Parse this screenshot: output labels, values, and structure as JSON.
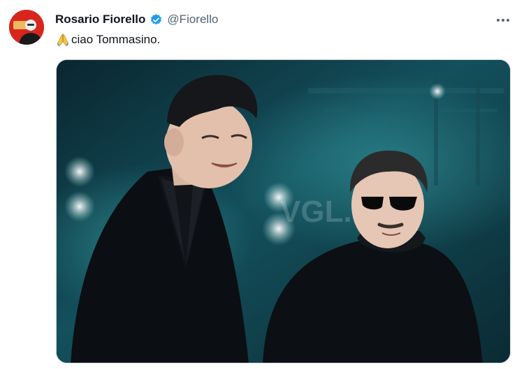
{
  "tweet": {
    "author": {
      "display_name": "Rosario Fiorello",
      "handle": "@Fiorello",
      "verified": true,
      "avatar_icon": "profile-avatar"
    },
    "text": "ciao Tommasino.",
    "text_emoji": "folded-hands-emoji",
    "more_icon": "more-horizontal-icon",
    "media": {
      "type": "photo",
      "watermark": "VGL.it"
    }
  },
  "colors": {
    "verified_blue": "#1d9bf0",
    "handle_gray": "#536471",
    "text": "#0f1419",
    "media_border": "#cfd9de"
  }
}
